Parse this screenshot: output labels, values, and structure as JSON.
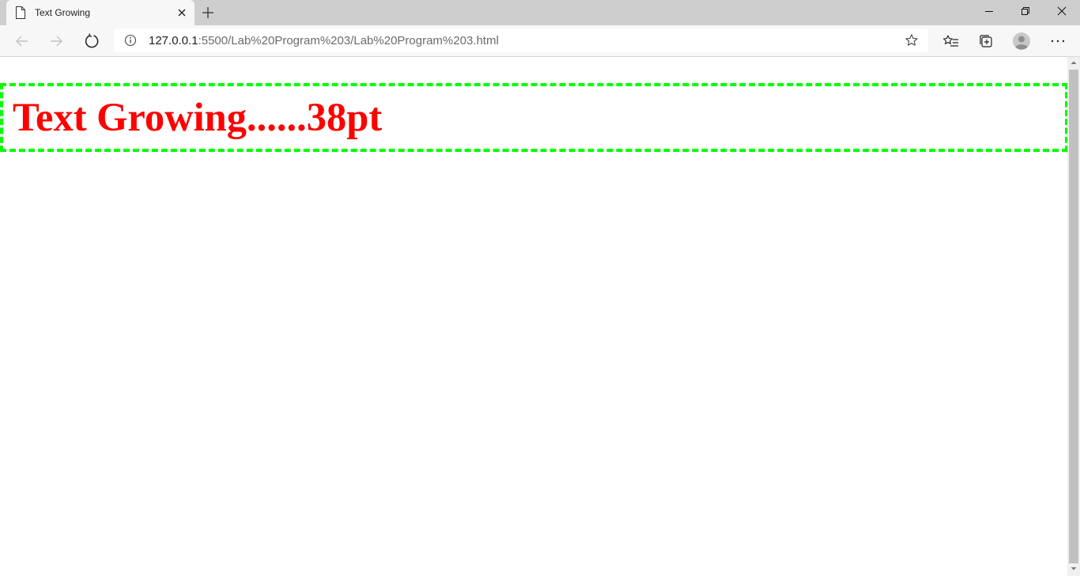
{
  "browser": {
    "tab_title": "Text Growing",
    "url_host": "127.0.0.1",
    "url_rest": ":5500/Lab%20Program%203/Lab%20Program%203.html"
  },
  "page": {
    "text": "Text Growing......38pt",
    "text_color": "#ff0000",
    "border_color": "#00ff00"
  }
}
